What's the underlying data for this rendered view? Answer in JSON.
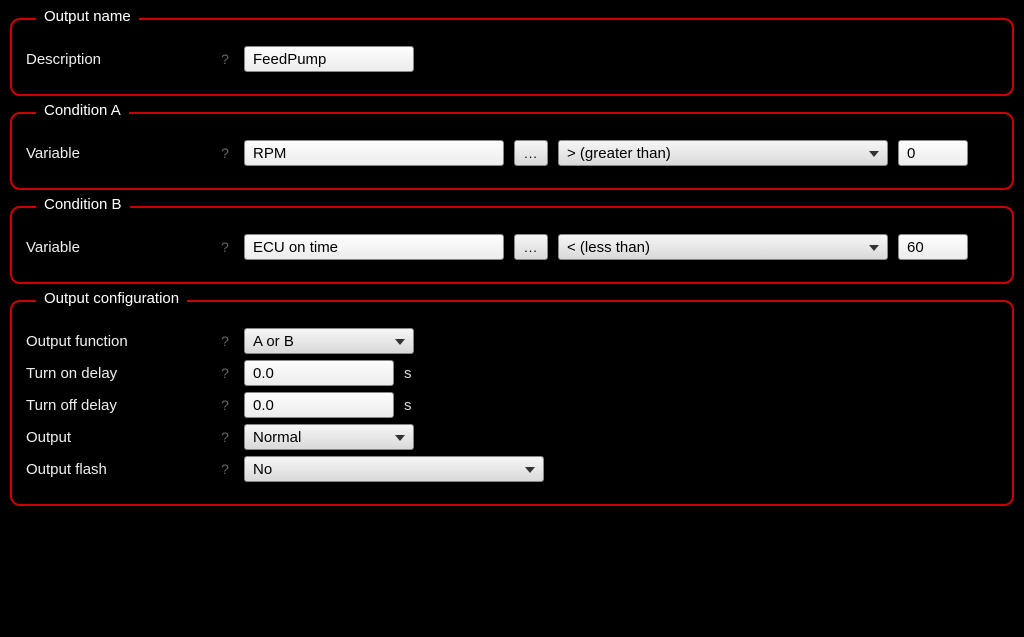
{
  "help_glyph": "?",
  "browse_glyph": "...",
  "output_name": {
    "legend": "Output name",
    "description_label": "Description",
    "description_value": "FeedPump"
  },
  "condition_a": {
    "legend": "Condition A",
    "variable_label": "Variable",
    "variable_value": "RPM",
    "operator": "> (greater than)",
    "threshold": "0"
  },
  "condition_b": {
    "legend": "Condition B",
    "variable_label": "Variable",
    "variable_value": "ECU on time",
    "operator": "< (less than)",
    "threshold": "60"
  },
  "output_config": {
    "legend": "Output configuration",
    "function_label": "Output function",
    "function_value": "A or B",
    "turn_on_delay_label": "Turn on delay",
    "turn_on_delay_value": "0.0",
    "turn_on_delay_unit": "s",
    "turn_off_delay_label": "Turn off delay",
    "turn_off_delay_value": "0.0",
    "turn_off_delay_unit": "s",
    "output_label": "Output",
    "output_value": "Normal",
    "flash_label": "Output flash",
    "flash_value": "No"
  }
}
